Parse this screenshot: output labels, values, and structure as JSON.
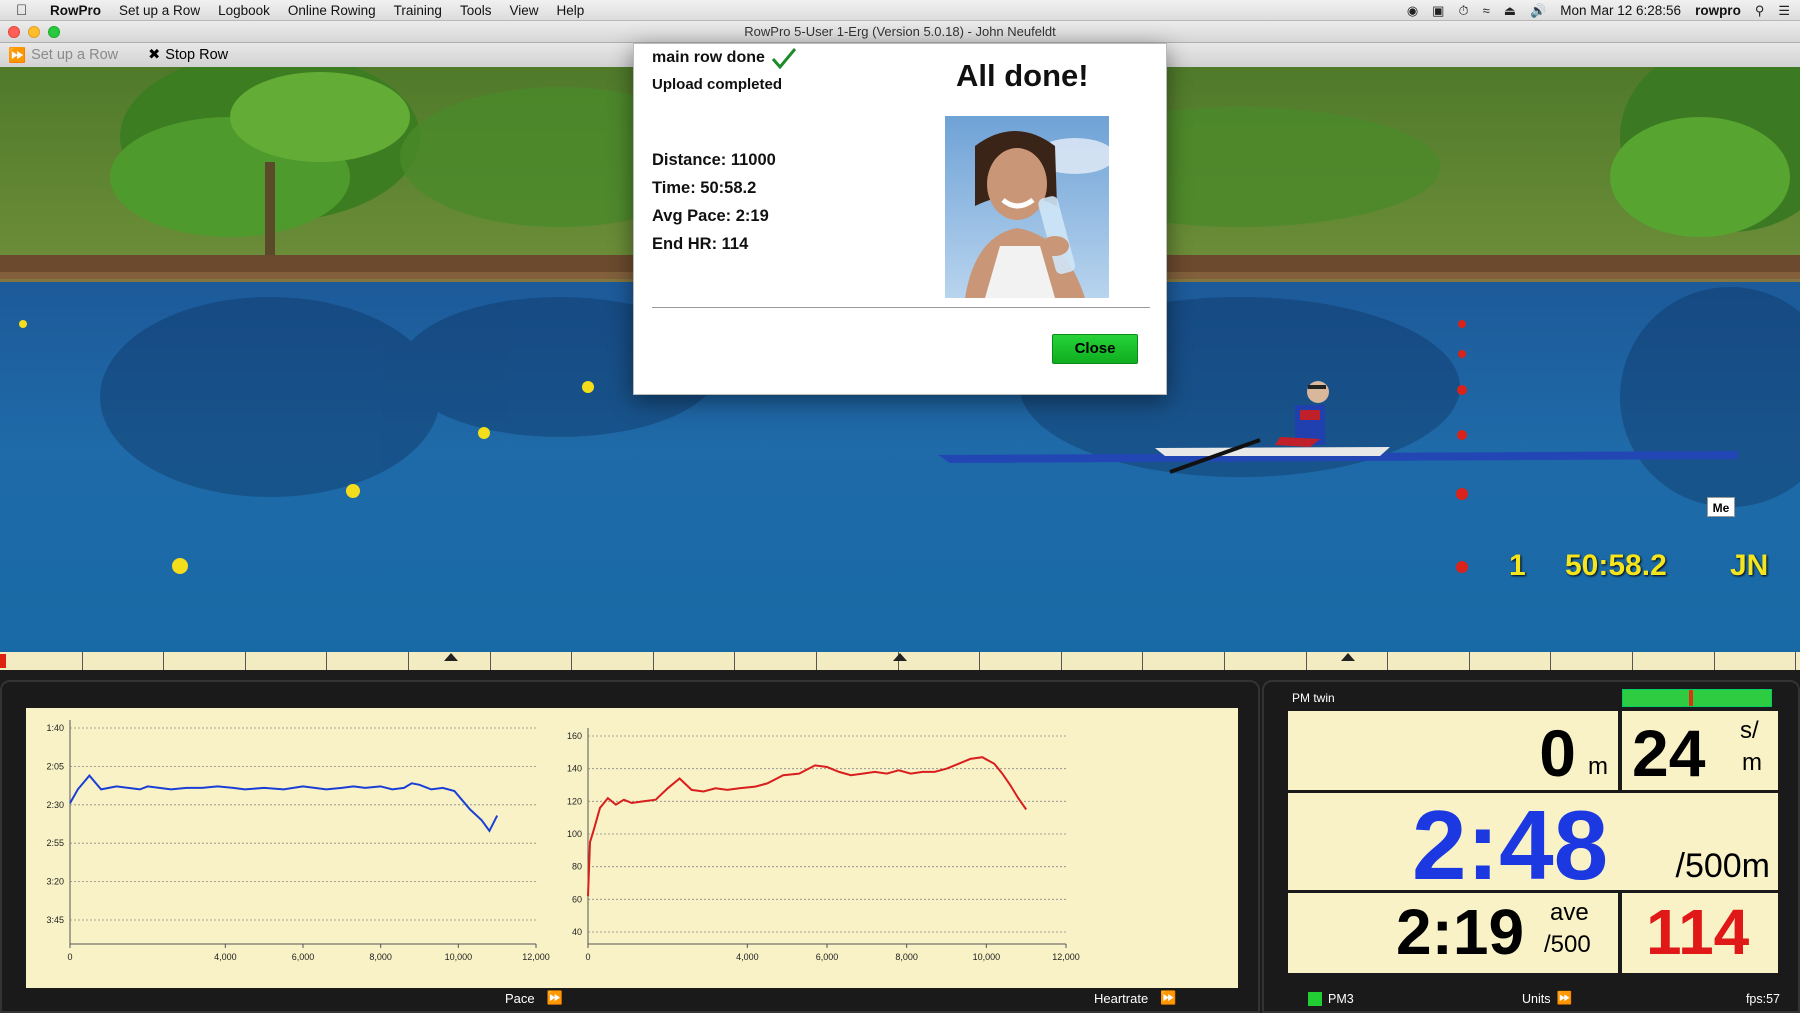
{
  "menubar": {
    "app": "RowPro",
    "items": [
      "Set up a Row",
      "Logbook",
      "Online Rowing",
      "Training",
      "Tools",
      "View",
      "Help"
    ],
    "clock": "Mon Mar 12  6:28:56",
    "user": "rowpro"
  },
  "window": {
    "title": "RowPro 5-User 1-Erg (Version 5.0.18) - John Neufeldt"
  },
  "toolbar": {
    "setup_label": "Set up a Row",
    "stop_label": "Stop Row"
  },
  "dialog": {
    "status1": "main row done",
    "status2": "Upload completed",
    "title": "All done!",
    "distance": "Distance: 11000",
    "time": "Time: 50:58.2",
    "avg_pace": "Avg Pace: 2:19",
    "end_hr": "End HR: 114",
    "close_label": "Close"
  },
  "scene": {
    "me_tag": "Me",
    "place": "1",
    "elapsed": "50:58.2",
    "initials": "JN"
  },
  "graphs": {
    "pace_label": "Pace",
    "heartrate_label": "Heartrate"
  },
  "chart_data": [
    {
      "type": "line",
      "title": "",
      "xlabel": "",
      "ylabel": "",
      "x_ticks": [
        "0",
        "4,000",
        "6,000",
        "8,000",
        "10,000",
        "12,000"
      ],
      "y_ticks": [
        "1:40",
        "2:05",
        "2:30",
        "2:55",
        "3:20",
        "3:45"
      ],
      "xlim": [
        0,
        12000
      ],
      "ylim_seconds": [
        100,
        225
      ],
      "reversed_y": true,
      "grid": true,
      "series": [
        {
          "color": "#1a3fd6",
          "x": [
            0,
            200,
            500,
            800,
            1000,
            1200,
            1500,
            1800,
            2000,
            2300,
            2600,
            3000,
            3400,
            3800,
            4200,
            4500,
            5000,
            5500,
            6000,
            6300,
            6600,
            7000,
            7300,
            7600,
            8000,
            8300,
            8600,
            8800,
            9000,
            9300,
            9600,
            9900,
            10100,
            10300,
            10600,
            10800,
            11000
          ],
          "y": [
            149,
            140,
            131,
            140,
            139,
            138,
            139,
            140,
            138,
            139,
            140,
            139,
            139,
            138,
            139,
            140,
            139,
            140,
            138,
            139,
            140,
            139,
            138,
            139,
            138,
            140,
            139,
            136,
            137,
            140,
            139,
            141,
            147,
            153,
            160,
            167,
            157
          ]
        }
      ]
    },
    {
      "type": "line",
      "title": "",
      "xlabel": "",
      "ylabel": "",
      "x_ticks": [
        "0",
        "4,000",
        "6,000",
        "8,000",
        "10,000",
        "12,000"
      ],
      "y_ticks": [
        "40",
        "60",
        "80",
        "100",
        "120",
        "140",
        "160"
      ],
      "xlim": [
        0,
        12000
      ],
      "ylim": [
        40,
        160
      ],
      "grid": true,
      "series": [
        {
          "color": "#d91e1e",
          "x": [
            0,
            50,
            150,
            300,
            500,
            700,
            900,
            1100,
            1400,
            1700,
            2000,
            2300,
            2600,
            2900,
            3200,
            3500,
            3800,
            4200,
            4500,
            4900,
            5300,
            5700,
            6000,
            6300,
            6600,
            6900,
            7200,
            7500,
            7800,
            8100,
            8400,
            8700,
            9000,
            9300,
            9600,
            9900,
            10200,
            10400,
            10600,
            10800,
            11000
          ],
          "y": [
            62,
            95,
            103,
            116,
            122,
            118,
            121,
            119,
            120,
            121,
            128,
            134,
            127,
            126,
            128,
            127,
            128,
            129,
            131,
            136,
            137,
            142,
            141,
            138,
            136,
            137,
            138,
            137,
            139,
            137,
            138,
            138,
            140,
            143,
            146,
            147,
            143,
            137,
            130,
            122,
            115
          ]
        }
      ]
    }
  ],
  "pm": {
    "header": "PM twin",
    "distance": "0",
    "distance_unit": "m",
    "rate": "24",
    "rate_unit_top": "s/",
    "rate_unit_bottom": "m",
    "pace": "2:48",
    "pace_unit": "/500m",
    "avg_pace": "2:19",
    "avg_unit_top": "ave",
    "avg_unit_bottom": "/500",
    "hr": "114",
    "monitor": "PM3",
    "units_label": "Units",
    "fps": "fps:57",
    "meter_fraction": 0.45
  }
}
